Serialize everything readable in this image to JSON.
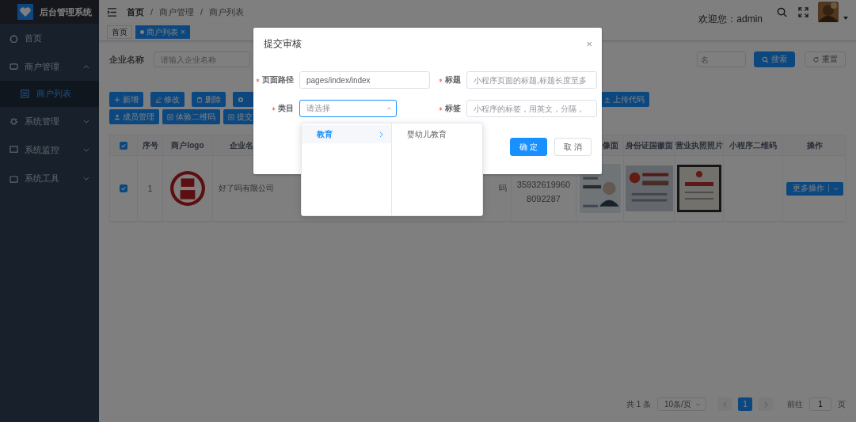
{
  "sidebar": {
    "title": "后台管理系统",
    "items": [
      {
        "label": "首页",
        "kind": "link"
      },
      {
        "label": "商户管理",
        "kind": "group",
        "expanded": true,
        "children": [
          {
            "label": "商户列表",
            "selected": true
          }
        ]
      },
      {
        "label": "系统管理",
        "kind": "group",
        "expanded": false
      },
      {
        "label": "系统监控",
        "kind": "group",
        "expanded": false
      },
      {
        "label": "系统工具",
        "kind": "group",
        "expanded": false
      }
    ]
  },
  "header": {
    "breadcrumb": [
      "首页",
      "商户管理",
      "商户列表"
    ],
    "separator": "/",
    "welcome": "欢迎您：admin"
  },
  "tabs": [
    {
      "label": "首页",
      "selected": false
    },
    {
      "label": "商户列表",
      "selected": true,
      "close": "×"
    }
  ],
  "search": {
    "label": "企业名称",
    "placeholder": "请输入企业名称",
    "second_placeholder": "名",
    "buttons": [
      {
        "label": "搜索",
        "kind": "primary"
      },
      {
        "label": "重置",
        "kind": "plain"
      }
    ]
  },
  "toolbar": {
    "top_buttons": [
      {
        "kind": "add",
        "label": "新增"
      },
      {
        "kind": "edit",
        "label": "修改"
      },
      {
        "kind": "delete",
        "label": "删除"
      },
      {
        "kind": "settings"
      },
      {
        "kind": "upload",
        "label": "上传代码"
      }
    ],
    "bottom_buttons": [
      {
        "kind": "member",
        "label": "成员管理"
      },
      {
        "kind": "qrcode",
        "label": "体验二维码"
      },
      {
        "kind": "submit",
        "label": "提交"
      }
    ]
  },
  "table": {
    "header_checked": true,
    "columns": [
      {
        "label": "序号"
      },
      {
        "label": "商户logo"
      },
      {
        "label": "企业名"
      },
      {},
      {},
      {
        "label": "像面"
      },
      {
        "label": "身份证国徽面"
      },
      {
        "label": "营业执照照片"
      },
      {
        "label": "小程序二维码"
      },
      {
        "label": "操作"
      }
    ],
    "rows": [
      {
        "checked": true,
        "index": "1",
        "company": "好了吗有限公司",
        "column_5": "吗",
        "id_number": "359326199608092287",
        "action": "更多操作"
      }
    ]
  },
  "pagination": {
    "total": "共 1 条",
    "page_size": "10条/页",
    "pages": [
      {
        "label": "1",
        "selected": true
      }
    ],
    "goto_label": "前往",
    "goto_value": "1",
    "goto_suffix": "页"
  },
  "dialog": {
    "title": "提交审核",
    "close": "×",
    "fields": [
      {
        "label": "页面路径",
        "required": true,
        "value": "pages/index/index"
      },
      {
        "label": "标题",
        "required": true,
        "placeholder": "小程序页面的标题,标题长度至多"
      },
      {
        "label": "类目",
        "required": true,
        "placeholder": "请选择",
        "kind": "select",
        "expanded": true
      },
      {
        "label": "标签",
        "required": true,
        "placeholder": "小程序的标签，用英文，分隔，"
      }
    ],
    "buttons": [
      {
        "label": "确 定",
        "kind": "primary"
      },
      {
        "label": "取 消",
        "kind": "plain"
      }
    ],
    "cascader": {
      "level_1": [
        {
          "label": "教育",
          "selected": true
        }
      ],
      "level_2": [
        {
          "label": "婴幼儿教育",
          "selected": false
        }
      ]
    }
  }
}
